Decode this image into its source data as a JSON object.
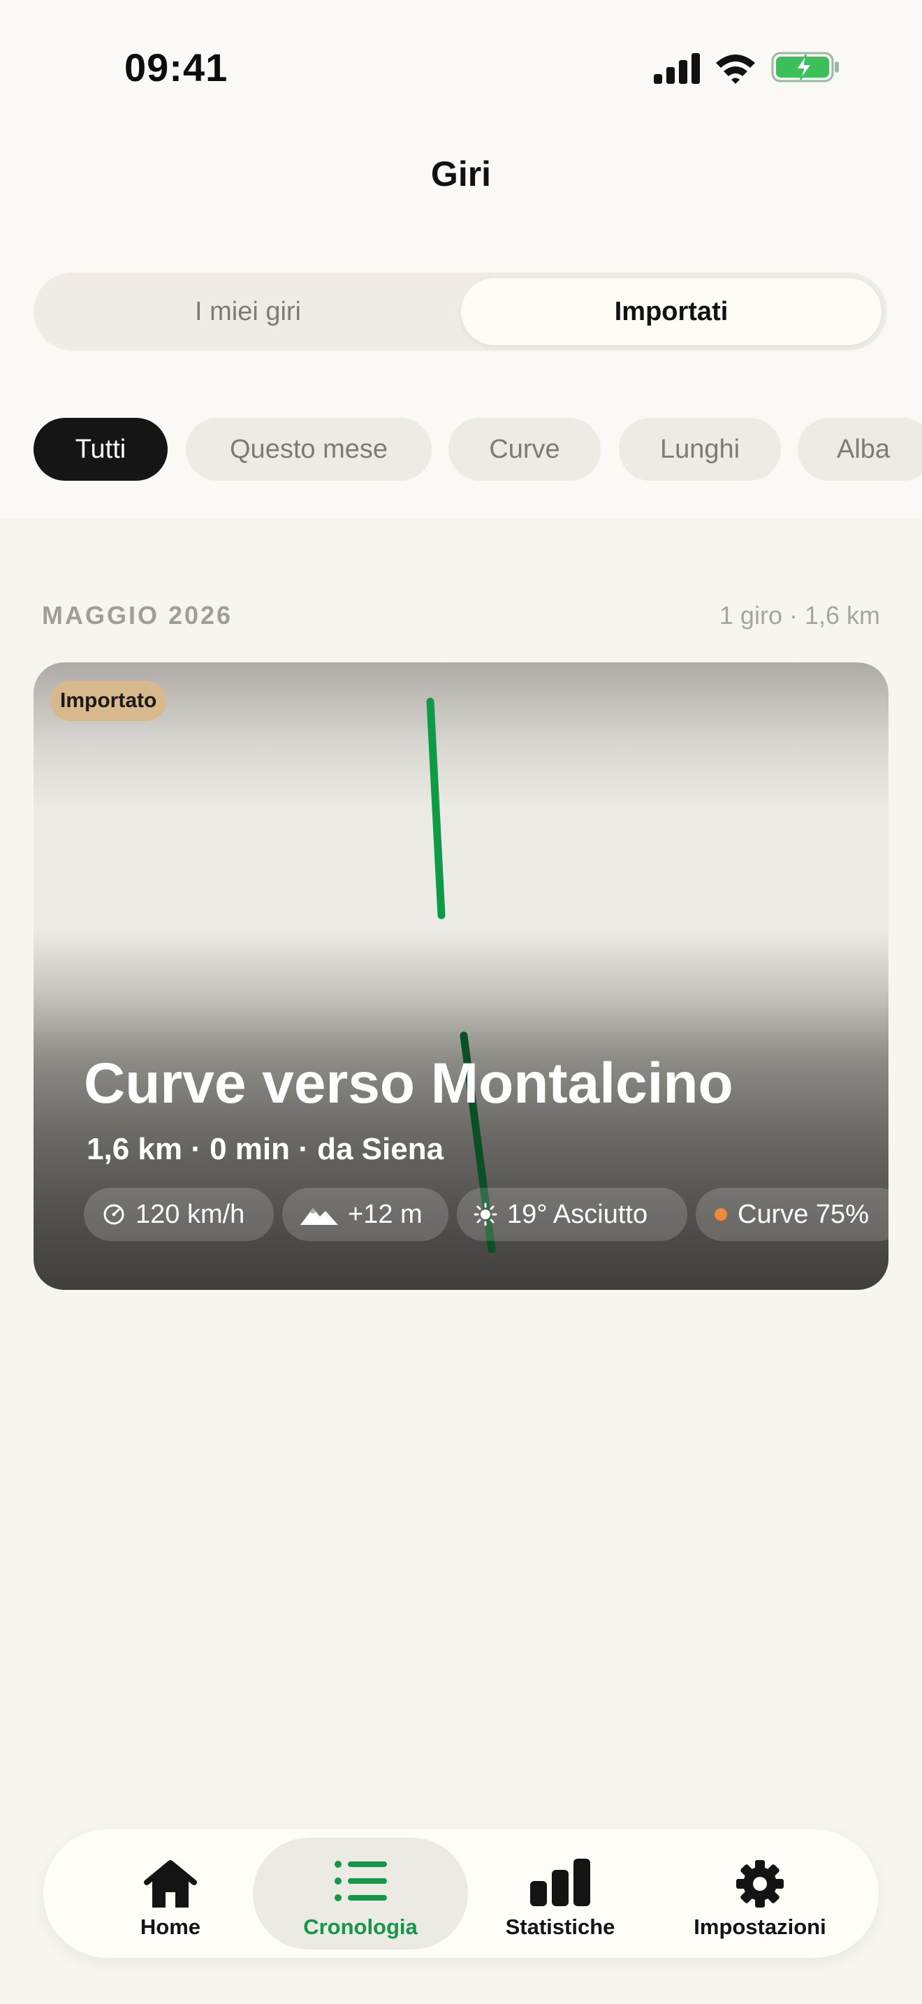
{
  "status_bar": {
    "time": "09:41"
  },
  "header": {
    "title": "Giri"
  },
  "segmented": {
    "left_label": "I miei giri",
    "right_label": "Importati",
    "selected": "Importati"
  },
  "filters": [
    {
      "label": "Tutti",
      "active": true
    },
    {
      "label": "Questo mese",
      "active": false
    },
    {
      "label": "Curve",
      "active": false
    },
    {
      "label": "Lunghi",
      "active": false
    },
    {
      "label": "Alba",
      "active": false
    }
  ],
  "section": {
    "title": "MAGGIO 2026",
    "meta": "1 giro · 1,6 km"
  },
  "ride_card": {
    "badge": "Importato",
    "title": "Curve verso Montalcino",
    "subtitle": "1,6 km · 0 min · da Siena",
    "stats": [
      {
        "icon": "speedometer-icon",
        "label": "120 km/h"
      },
      {
        "icon": "mountain-icon",
        "label": "+12 m"
      },
      {
        "icon": "sun-icon",
        "label": "19° Asciutto"
      },
      {
        "icon": "orange-dot-icon",
        "label": "Curve 75%"
      }
    ],
    "route_color": "#0f9a47"
  },
  "tabbar": {
    "items": [
      {
        "label": "Home",
        "icon": "home-icon",
        "active": false
      },
      {
        "label": "Cronologia",
        "icon": "list-icon",
        "active": true
      },
      {
        "label": "Statistiche",
        "icon": "bar-chart-icon",
        "active": false
      },
      {
        "label": "Impostazioni",
        "icon": "gear-icon",
        "active": false
      }
    ]
  },
  "colors": {
    "accent": "#16964a",
    "badge": "#d8b98e",
    "dot": "#ef8a3a"
  }
}
